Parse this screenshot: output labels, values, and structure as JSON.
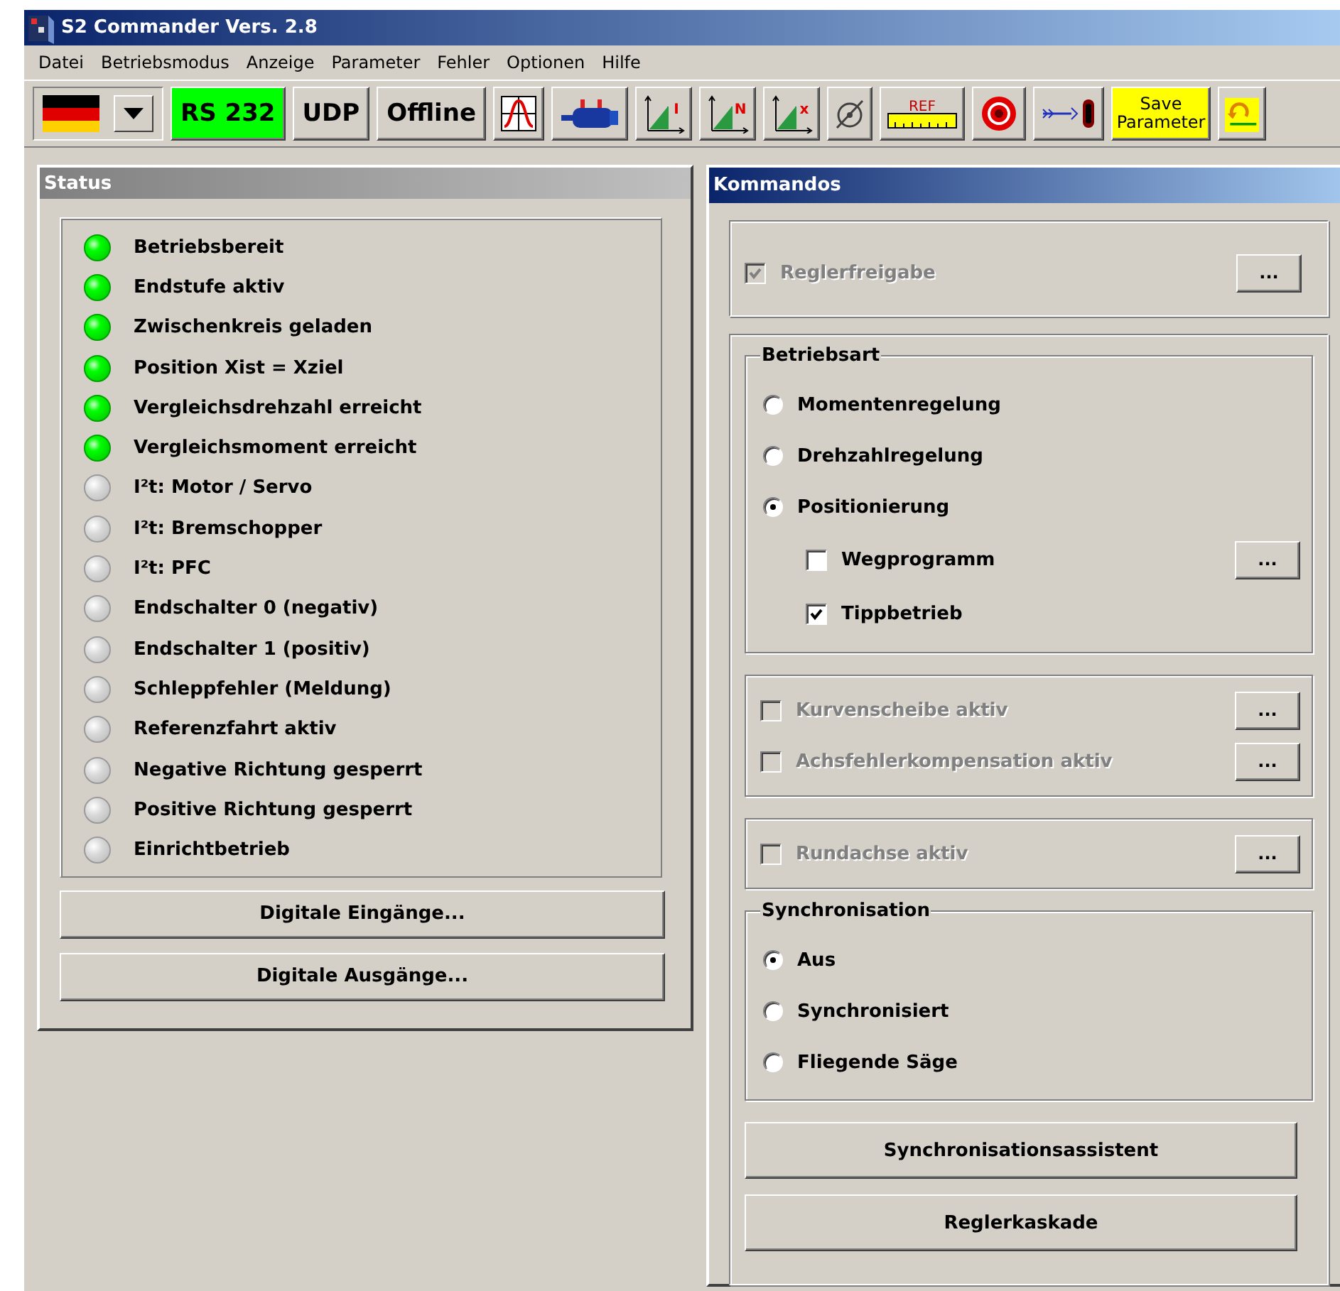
{
  "window": {
    "title": "S2 Commander Vers. 2.8"
  },
  "menu": [
    "Datei",
    "Betriebsmodus",
    "Anzeige",
    "Parameter",
    "Fehler",
    "Optionen",
    "Hilfe"
  ],
  "toolbar": [
    {
      "kind": "language"
    },
    {
      "kind": "text",
      "label": "RS 232",
      "color": "#00ff00"
    },
    {
      "kind": "text",
      "label": "UDP"
    },
    {
      "kind": "text",
      "label": "Offline"
    },
    {
      "kind": "icon"
    },
    {
      "kind": "icon"
    },
    {
      "kind": "icon",
      "label": "I"
    },
    {
      "kind": "icon",
      "label": "N"
    },
    {
      "kind": "icon",
      "label": "x"
    },
    {
      "kind": "icon"
    },
    {
      "kind": "icon",
      "label": "REF"
    },
    {
      "kind": "icon"
    },
    {
      "kind": "icon"
    },
    {
      "kind": "text",
      "label": "Save Parameter",
      "color": "#ffff00"
    },
    {
      "kind": "icon"
    }
  ],
  "status": {
    "title": "Status",
    "leds": [
      {
        "label": "Betriebsbereit",
        "on": true
      },
      {
        "label": "Endstufe aktiv",
        "on": true
      },
      {
        "label": "Zwischenkreis geladen",
        "on": true
      },
      {
        "label": "Position Xist = Xziel",
        "on": true
      },
      {
        "label": "Vergleichsdrehzahl erreicht",
        "on": true
      },
      {
        "label": "Vergleichsmoment erreicht",
        "on": true
      },
      {
        "label": "I²t: Motor / Servo",
        "on": false
      },
      {
        "label": "I²t: Bremschopper",
        "on": false
      },
      {
        "label": "I²t: PFC",
        "on": false
      },
      {
        "label": "Endschalter 0 (negativ)",
        "on": false
      },
      {
        "label": "Endschalter 1 (positiv)",
        "on": false
      },
      {
        "label": "Schleppfehler (Meldung)",
        "on": false
      },
      {
        "label": "Referenzfahrt aktiv",
        "on": false
      },
      {
        "label": "Negative Richtung gesperrt",
        "on": false
      },
      {
        "label": "Positive Richtung gesperrt",
        "on": false
      },
      {
        "label": "Einrichtbetrieb",
        "on": false
      }
    ],
    "buttons": [
      "Digitale Eingänge...",
      "Digitale Ausgänge..."
    ]
  },
  "kommandos": {
    "title": "Kommandos",
    "enable": {
      "kind": "check",
      "label": "Reglerfreigabe",
      "checked": true,
      "disabled": true,
      "more": "..."
    },
    "sections": [
      {
        "kind": "fieldset",
        "title": "Betriebsart",
        "items": [
          {
            "kind": "radio",
            "label": "Momentenregelung",
            "selected": false
          },
          {
            "kind": "radio",
            "label": "Drehzahlregelung",
            "selected": false
          },
          {
            "kind": "radio",
            "label": "Positionierung",
            "selected": true,
            "children": [
              {
                "kind": "check",
                "label": "Wegprogramm",
                "checked": false,
                "disabled": false,
                "more": "..."
              },
              {
                "kind": "check",
                "label": "Tippbetrieb",
                "checked": true,
                "disabled": false
              }
            ]
          }
        ]
      },
      {
        "kind": "frame",
        "items": [
          {
            "kind": "check",
            "label": "Kurvenscheibe aktiv",
            "checked": false,
            "disabled": true,
            "more": "..."
          },
          {
            "kind": "check",
            "label": "Achsfehlerkompensation aktiv",
            "checked": false,
            "disabled": true,
            "more": "..."
          }
        ]
      },
      {
        "kind": "frame",
        "items": [
          {
            "kind": "check",
            "label": "Rundachse aktiv",
            "checked": false,
            "disabled": true,
            "more": "..."
          }
        ]
      },
      {
        "kind": "fieldset",
        "title": "Synchronisation",
        "items": [
          {
            "kind": "radio",
            "label": "Aus",
            "selected": true
          },
          {
            "kind": "radio",
            "label": "Synchronisiert",
            "selected": false
          },
          {
            "kind": "radio",
            "label": "Fliegende Säge",
            "selected": false
          }
        ]
      }
    ],
    "buttons": [
      "Synchronisationsassistent",
      "Reglerkaskade"
    ]
  }
}
